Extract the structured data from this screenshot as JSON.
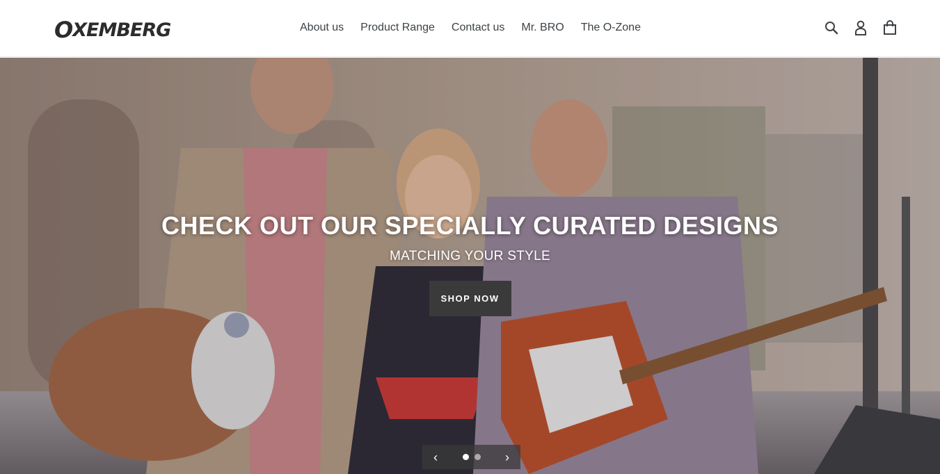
{
  "brand": {
    "logo_first": "O",
    "logo_rest": "XEMBERG"
  },
  "nav": [
    {
      "label": "About us"
    },
    {
      "label": "Product Range"
    },
    {
      "label": "Contact us"
    },
    {
      "label": "Mr. BRO"
    },
    {
      "label": "The O-Zone"
    }
  ],
  "header_icons": [
    "search-icon",
    "account-icon",
    "cart-icon"
  ],
  "hero": {
    "headline": "CHECK OUT OUR SPECIALLY CURATED DESIGNS",
    "subheadline": "MATCHING YOUR STYLE",
    "cta_label": "SHOP NOW",
    "slides_total": 2,
    "active_slide": 1,
    "prev_arrow": "‹",
    "next_arrow": "›"
  },
  "colors": {
    "button_bg": "#3a3a3a",
    "nav_text": "#3d4246"
  }
}
